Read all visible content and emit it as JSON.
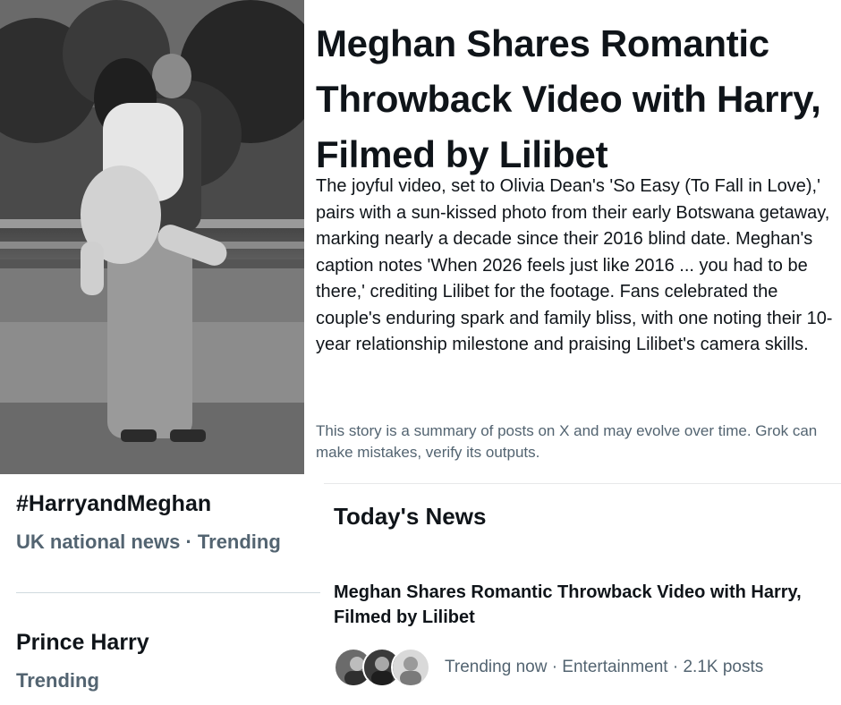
{
  "story": {
    "photo_description_icon": "couple-hug-photo",
    "headline": "Meghan Shares Romantic Throwback Video with Harry, Filmed by Lilibet",
    "summary": "The joyful video, set to Olivia Dean's 'So Easy (To Fall in Love),' pairs with a sun-kissed photo from their early Botswana getaway, marking nearly a decade since their 2016 blind date. Meghan's caption notes 'When 2026 feels just like 2016 ... you had to be there,' crediting Lilibet for the footage. Fans celebrated the couple's enduring spark and family bliss, with one noting their 10-year relationship milestone and praising Lilibet's camera skills.",
    "disclaimer": "This story is a summary of posts on X and may evolve over time. Grok can make mistakes, verify its outputs."
  },
  "trends": [
    {
      "title": "#HarryandMeghan",
      "meta": "UK national news · Trending"
    },
    {
      "title": "Prince Harry",
      "meta": "Trending"
    }
  ],
  "todays_news": {
    "heading": "Today's News",
    "item": {
      "title": "Meghan Shares Romantic Throwback Video with Harry, Filmed by Lilibet",
      "meta": "Trending now · Entertainment · 2.1K posts",
      "avatar_icons": [
        "avatar-1-icon",
        "avatar-2-icon",
        "avatar-3-icon"
      ]
    }
  },
  "colors": {
    "text_primary": "#0f1419",
    "text_secondary": "#536471",
    "divider": "#e7e9ea"
  }
}
